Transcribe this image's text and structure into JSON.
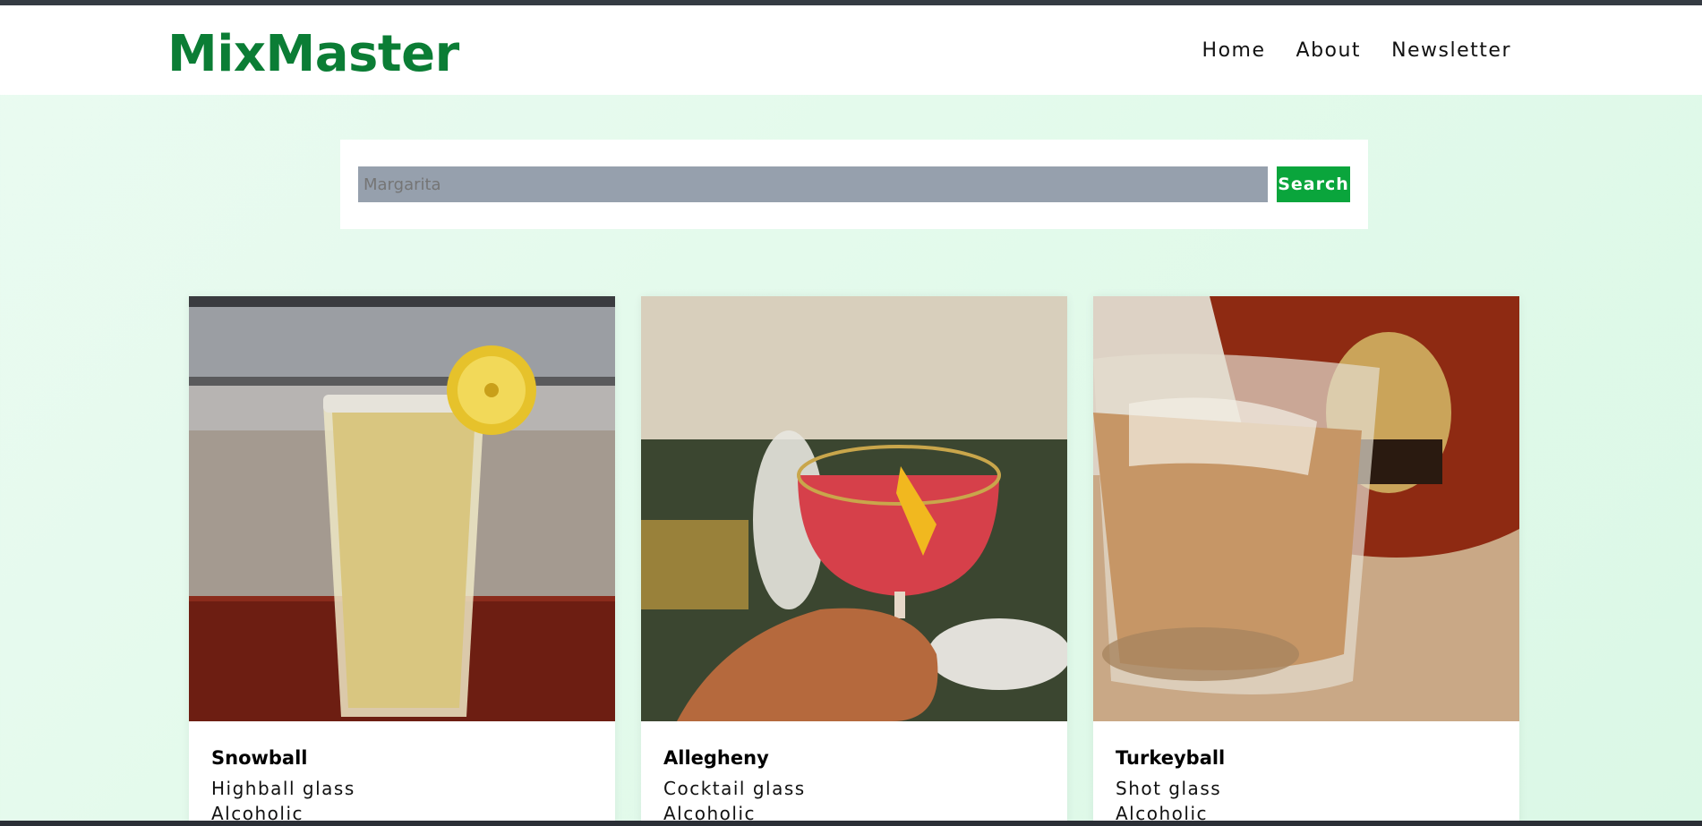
{
  "header": {
    "logo": "MixMaster",
    "nav": [
      {
        "label": "Home"
      },
      {
        "label": "About"
      },
      {
        "label": "Newsletter"
      }
    ]
  },
  "search": {
    "value": "",
    "placeholder": "Margarita",
    "button_label": "Search"
  },
  "cards": [
    {
      "name": "Snowball",
      "glass": "Highball glass",
      "type": "Alcoholic"
    },
    {
      "name": "Allegheny",
      "glass": "Cocktail glass",
      "type": "Alcoholic"
    },
    {
      "name": "Turkeyball",
      "glass": "Shot glass",
      "type": "Alcoholic"
    }
  ],
  "colors": {
    "brand": "#0b7d35",
    "search_button": "#0aa53c",
    "search_field": "#96a0ad"
  }
}
